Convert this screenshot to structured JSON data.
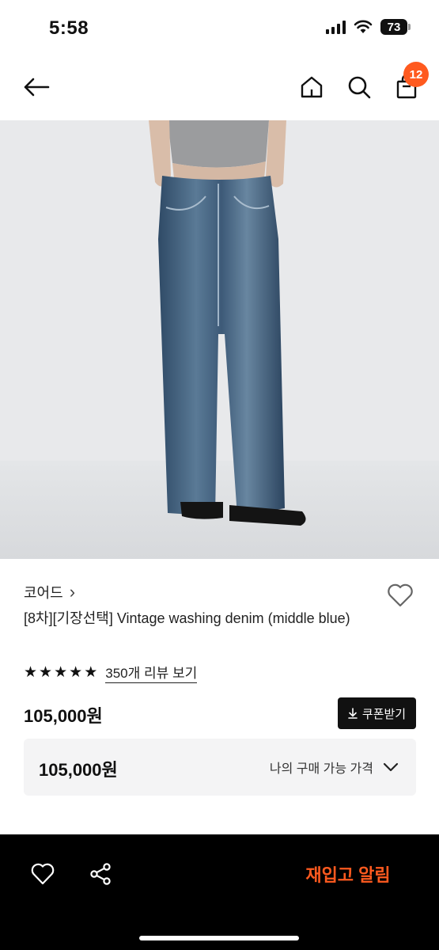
{
  "status_bar": {
    "time": "5:58",
    "battery": "73"
  },
  "header": {
    "back_icon": "arrow-left-icon",
    "home_icon": "home-icon",
    "search_icon": "search-icon",
    "bag_icon": "shopping-bag-icon",
    "cart_count": "12",
    "badge_color": "#ff5a1f"
  },
  "product": {
    "image_alt": "Vintage washing denim jeans photo",
    "brand": "코어드",
    "brand_chevron": "›",
    "title": "[8차][기장선택] Vintage washing denim (middle blue)",
    "rating": {
      "stars": 5,
      "star_glyph": "★",
      "review_link": "350개 리뷰 보기"
    },
    "price": "105,000원",
    "coupon_button": "쿠폰받기",
    "my_price": {
      "value": "105,000원",
      "label": "나의 구매 가능 가격"
    },
    "peek_text": "· · · · · · · · ·"
  },
  "bottom_bar": {
    "like_icon": "heart-icon",
    "share_icon": "share-icon",
    "restock_label": "재입고 알림",
    "accent_color": "#ff5a1f"
  }
}
